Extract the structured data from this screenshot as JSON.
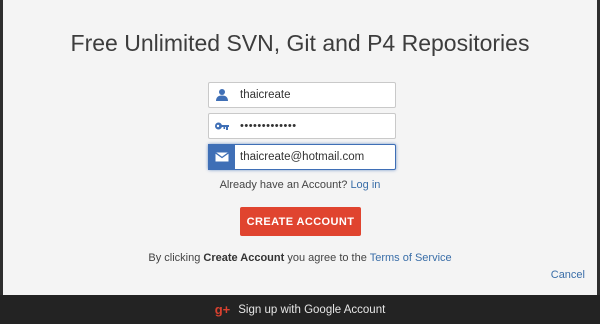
{
  "modal": {
    "title": "Free Unlimited SVN, Git and P4 Repositories"
  },
  "form": {
    "username_value": "thaicreate",
    "password_value": "•••••••••••••",
    "email_value": "thaicreate@hotmail.com"
  },
  "login_prompt": {
    "text": "Already have an Account?",
    "link": "Log in"
  },
  "create_button": {
    "label": "CREATE ACCOUNT"
  },
  "terms": {
    "prefix": "By clicking",
    "bold": "Create Account",
    "middle": "you agree to the",
    "link": "Terms of Service"
  },
  "cancel_label": "Cancel",
  "google": {
    "icon_text": "g+",
    "label": "Sign up with Google Account"
  },
  "icons": {
    "username": "user-icon",
    "password": "key-icon",
    "email": "envelope-icon"
  },
  "colors": {
    "accent_red": "#e0442f",
    "link_blue": "#3a6ea8",
    "focus_blue": "#3f6fb6"
  }
}
